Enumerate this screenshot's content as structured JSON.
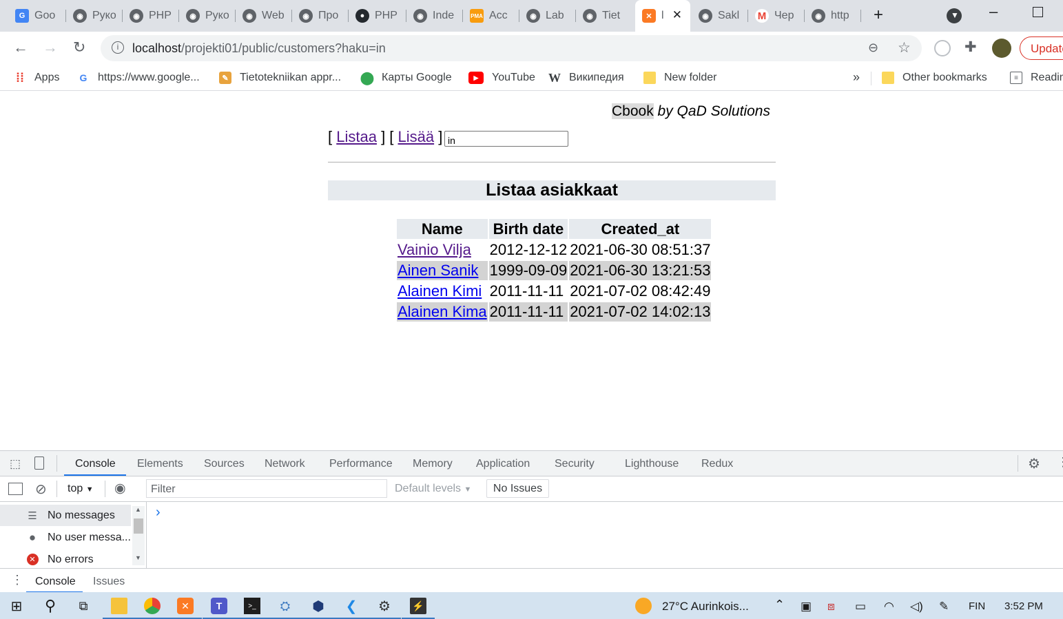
{
  "browser": {
    "tabs": [
      {
        "title": "Goo",
        "icon": "google-translate-icon"
      },
      {
        "title": "Руко",
        "icon": "globe-icon"
      },
      {
        "title": "PHP",
        "icon": "globe-icon"
      },
      {
        "title": "Руко",
        "icon": "globe-icon"
      },
      {
        "title": "Web",
        "icon": "globe-icon"
      },
      {
        "title": "Про",
        "icon": "globe-icon"
      },
      {
        "title": "PHP",
        "icon": "github-icon"
      },
      {
        "title": "Inde",
        "icon": "globe-icon"
      },
      {
        "title": "Acc",
        "icon": "phpmyadmin-icon"
      },
      {
        "title": "Lab",
        "icon": "globe-icon"
      },
      {
        "title": "Tiet",
        "icon": "globe-icon"
      },
      {
        "title": "l",
        "icon": "xampp-icon",
        "active": true
      },
      {
        "title": "Sakl",
        "icon": "globe-icon"
      },
      {
        "title": "Чер",
        "icon": "gmail-icon"
      },
      {
        "title": "http",
        "icon": "globe-icon"
      }
    ],
    "new_tab_glyph": "+",
    "url_host": "localhost",
    "url_path": "/projekti01/public/customers?haku=in",
    "update_label": "Update",
    "bookmarks": [
      {
        "label": "Apps",
        "icon": "apps-grid-icon"
      },
      {
        "label": "https://www.google...",
        "icon": "google-icon"
      },
      {
        "label": "Tietotekniikan appr...",
        "icon": "bookmark-favicon-icon"
      },
      {
        "label": "Карты Google",
        "icon": "google-maps-icon"
      },
      {
        "label": "YouTube",
        "icon": "youtube-icon"
      },
      {
        "label": "Википедия",
        "icon": "wikipedia-icon"
      },
      {
        "label": "New folder",
        "icon": "folder-icon"
      }
    ],
    "overflow_glyph": "»",
    "other_bookmarks": "Other bookmarks",
    "reading_list": "Readin"
  },
  "page": {
    "brand_name": "Cbook",
    "brand_by": "by QaD Solutions",
    "nav": {
      "list_label": "Listaa",
      "add_label": "Lisää"
    },
    "search_value": "in",
    "heading": "Listaa asiakkaat",
    "table": {
      "headers": [
        "Name",
        "Birth date",
        "Created_at"
      ],
      "rows": [
        {
          "name": "Vainio Vilja",
          "birth": "2012-12-12",
          "created": "2021-06-30 08:51:37"
        },
        {
          "name": "Ainen Sanik",
          "birth": "1999-09-09",
          "created": "2021-06-30 13:21:53"
        },
        {
          "name": "Alainen Kimi",
          "birth": "2011-11-11",
          "created": "2021-07-02 08:42:49"
        },
        {
          "name": "Alainen Kima",
          "birth": "2011-11-11",
          "created": "2021-07-02 14:02:13"
        }
      ]
    }
  },
  "devtools": {
    "tabs": [
      "Console",
      "Elements",
      "Sources",
      "Network",
      "Performance",
      "Memory",
      "Application",
      "Security",
      "Lighthouse",
      "Redux"
    ],
    "context": "top",
    "filter_placeholder": "Filter",
    "levels": "Default levels",
    "issues": "No Issues",
    "sidebar": [
      "No messages",
      "No user messa...",
      "No errors"
    ],
    "prompt": "›",
    "drawer_tabs": [
      "Console",
      "Issues"
    ]
  },
  "taskbar": {
    "weather": "27°C  Aurinkois...",
    "lang": "FIN",
    "time": "3:52 PM"
  }
}
